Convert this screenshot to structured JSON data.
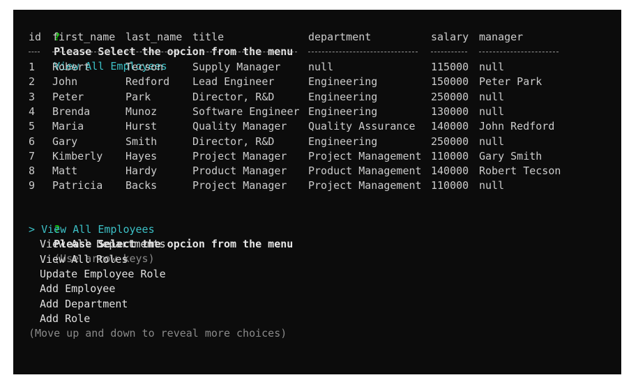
{
  "prompt1": {
    "mark": "?",
    "question": "Please Select the opcion from the menu",
    "answer": "View All Employees"
  },
  "table": {
    "headers": {
      "id": "id",
      "first_name": "first_name",
      "last_name": "last_name",
      "title": "title",
      "department": "department",
      "salary": "salary",
      "manager": "manager"
    },
    "rows": [
      {
        "id": "1",
        "first_name": "Robert",
        "last_name": "Tecson",
        "title": "Supply Manager",
        "department": "null",
        "salary": "115000",
        "manager": "null"
      },
      {
        "id": "2",
        "first_name": "John",
        "last_name": "Redford",
        "title": "Lead Engineer",
        "department": "Engineering",
        "salary": "150000",
        "manager": "Peter Park"
      },
      {
        "id": "3",
        "first_name": "Peter",
        "last_name": "Park",
        "title": "Director, R&D",
        "department": "Engineering",
        "salary": "250000",
        "manager": "null"
      },
      {
        "id": "4",
        "first_name": "Brenda",
        "last_name": "Munoz",
        "title": "Software Engineer",
        "department": "Engineering",
        "salary": "130000",
        "manager": "null"
      },
      {
        "id": "5",
        "first_name": "Maria",
        "last_name": "Hurst",
        "title": "Quality Manager",
        "department": "Quality Assurance",
        "salary": "140000",
        "manager": "John Redford"
      },
      {
        "id": "6",
        "first_name": "Gary",
        "last_name": "Smith",
        "title": "Director, R&D",
        "department": "Engineering",
        "salary": "250000",
        "manager": "null"
      },
      {
        "id": "7",
        "first_name": "Kimberly",
        "last_name": "Hayes",
        "title": "Project Manager",
        "department": "Project Management",
        "salary": "110000",
        "manager": "Gary Smith"
      },
      {
        "id": "8",
        "first_name": "Matt",
        "last_name": "Hardy",
        "title": "Product Manager",
        "department": "Product Management",
        "salary": "140000",
        "manager": "Robert Tecson"
      },
      {
        "id": "9",
        "first_name": "Patricia",
        "last_name": "Backs",
        "title": "Project Manager",
        "department": "Project Management",
        "salary": "110000",
        "manager": "null"
      }
    ]
  },
  "prompt2": {
    "mark": "?",
    "question": "Please Select the opcion from the menu",
    "hint": "(Use arrow keys)"
  },
  "menu": {
    "pointer": ">",
    "items": [
      "View All Employees",
      "View All Departments",
      "View All Roles",
      "Update Employee Role",
      "Add Employee",
      "Add Department",
      "Add Role"
    ],
    "footer": "(Move up and down to reveal more choices)"
  },
  "colors": {
    "background": "#0c0c0c",
    "text": "#cccccc",
    "prompt_mark": "#16c60c",
    "highlight": "#3cc0c6",
    "hint": "#8a8a8a"
  }
}
